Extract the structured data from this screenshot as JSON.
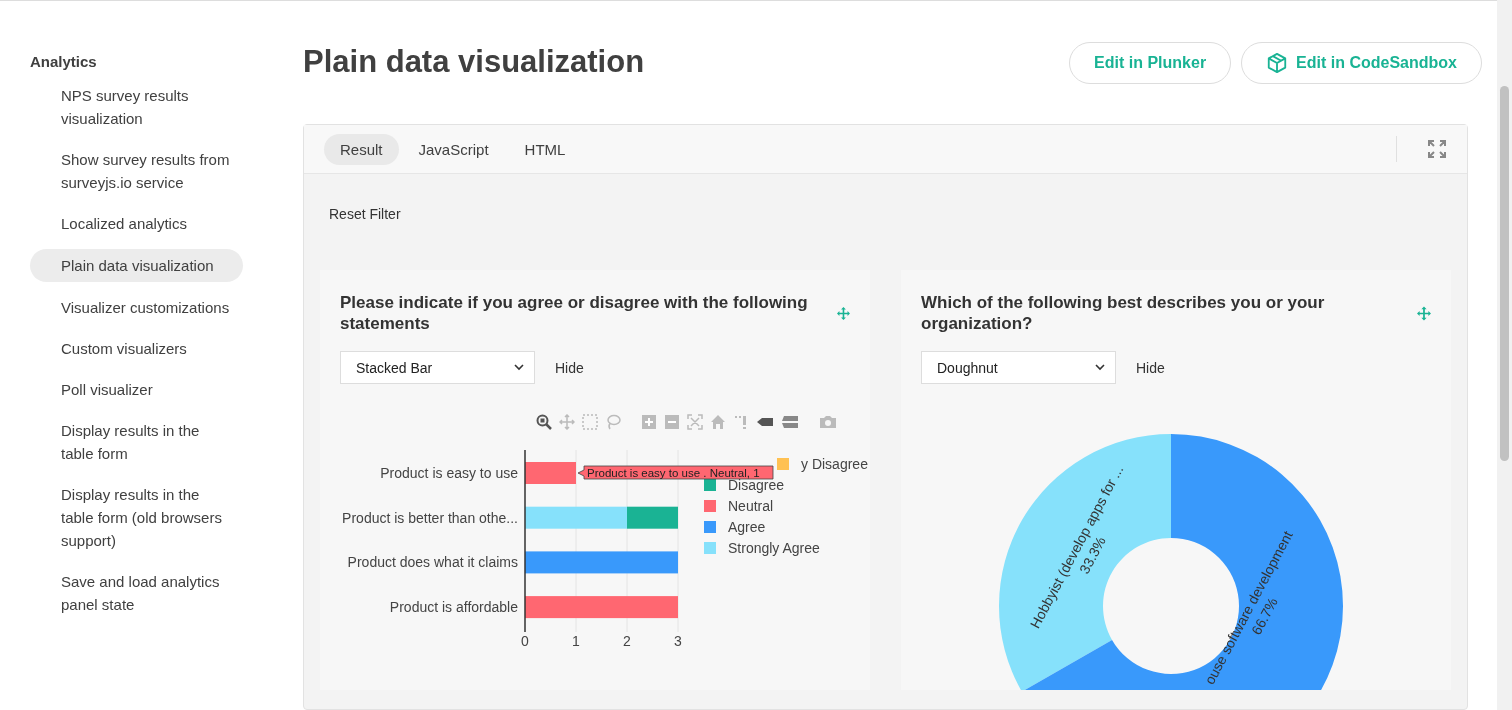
{
  "sidebar": {
    "heading": "Analytics",
    "items": [
      {
        "label": "NPS survey results visualization",
        "selected": false
      },
      {
        "label": "Show survey results from surveyjs.io service",
        "selected": false
      },
      {
        "label": "Localized analytics",
        "selected": false
      },
      {
        "label": "Plain data visualization",
        "selected": true
      },
      {
        "label": "Visualizer customizations",
        "selected": false
      },
      {
        "label": "Custom visualizers",
        "selected": false
      },
      {
        "label": "Poll visualizer",
        "selected": false
      },
      {
        "label": "Display results in the table form",
        "selected": false
      },
      {
        "label": "Display results in the table form (old browsers support)",
        "selected": false
      },
      {
        "label": "Save and load analytics panel state",
        "selected": false
      }
    ]
  },
  "header": {
    "title": "Plain data visualization",
    "buttons": [
      {
        "label": "Edit in Plunker",
        "kind": "plain"
      },
      {
        "label": "Edit in CodeSandbox",
        "kind": "sandbox"
      }
    ]
  },
  "demo": {
    "tabs": [
      {
        "label": "Result",
        "selected": true
      },
      {
        "label": "JavaScript",
        "selected": false
      },
      {
        "label": "HTML",
        "selected": false
      }
    ],
    "reset_filter": "Reset Filter",
    "cards": [
      {
        "title": "Please indicate if you agree or disagree with the following statements",
        "chart_type": "Stacked Bar",
        "hide": "Hide",
        "tooltip": "Product is easy to use . Neutral, 1",
        "chart_data": {
          "type": "bar",
          "orientation": "h",
          "stacked": true,
          "legend": "right",
          "categories": [
            "Product is easy to use",
            "Product is better than othe...",
            "Product does what it claims",
            "Product is affordable"
          ],
          "xticks": [
            0,
            1,
            2,
            3
          ],
          "xlim": [
            0,
            3
          ],
          "series": [
            {
              "name": "y Disagree",
              "color": "#ffc152",
              "values": [
                null,
                0,
                0,
                0
              ]
            },
            {
              "name": "Disagree",
              "color": "#1ab394",
              "values": [
                0,
                1,
                0,
                0
              ]
            },
            {
              "name": "Neutral",
              "color": "#ff6771",
              "values": [
                1,
                0,
                0,
                3
              ]
            },
            {
              "name": "Agree",
              "color": "#3999fb",
              "values": [
                0,
                0,
                3,
                0
              ]
            },
            {
              "name": "Strongly Agree",
              "color": "#86e1fb",
              "values": [
                0,
                2,
                0,
                0
              ]
            }
          ]
        }
      },
      {
        "title": "Which of the following best describes you or your organization?",
        "chart_type": "Doughnut",
        "hide": "Hide",
        "chart_data": {
          "type": "donut",
          "categories": [
            "Hobbyist (develop apps for ...",
            "ouse software development"
          ],
          "values": [
            33.3,
            66.7
          ],
          "value_labels": [
            "33.3%",
            "66.7%"
          ],
          "colors": [
            "#86e1fb",
            "#3999fb"
          ]
        }
      }
    ]
  }
}
